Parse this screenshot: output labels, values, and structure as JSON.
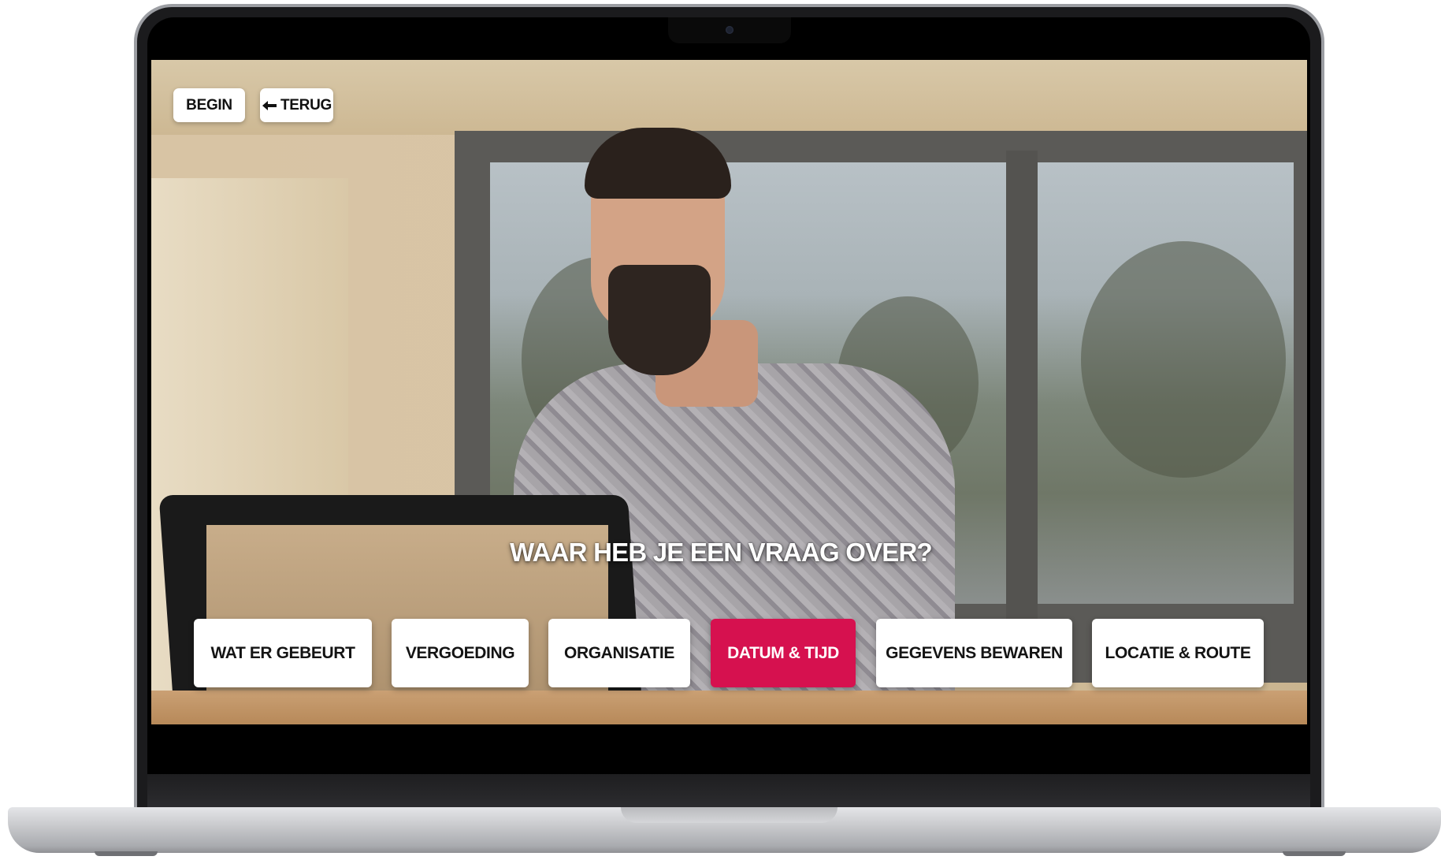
{
  "nav": {
    "begin_label": "BEGIN",
    "back_label": "TERUG",
    "back_icon": "arrow-left-icon"
  },
  "question": "WAAR HEB JE EEN VRAAG OVER?",
  "options": [
    {
      "label": "WAT ER GEBEURT",
      "selected": false
    },
    {
      "label": "VERGOEDING",
      "selected": false
    },
    {
      "label": "ORGANISATIE",
      "selected": false
    },
    {
      "label": "DATUM & TIJD",
      "selected": true
    },
    {
      "label": "GEGEVENS BEWAREN",
      "selected": false
    },
    {
      "label": "LOCATIE & ROUTE",
      "selected": false
    }
  ],
  "colors": {
    "accent": "#d6114f",
    "button_bg": "#ffffff",
    "button_text": "#141414"
  }
}
